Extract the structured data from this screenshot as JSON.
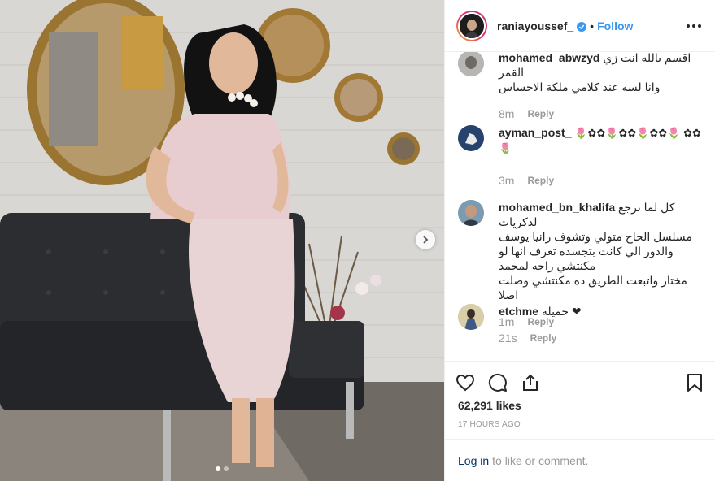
{
  "header": {
    "username": "raniayoussef_",
    "separator": "•",
    "follow_label": "Follow"
  },
  "comments": [
    {
      "username": "mohamed_abwzyd",
      "text_line1": "اقسم بالله انت زي القمر",
      "text_line2": "وانا لسه عند كلامي ملكة الاحساس",
      "time": "8m",
      "reply": "Reply"
    },
    {
      "username": "ayman_post_",
      "text": "🌷✿✿🌷✿✿🌷✿✿🌷 ✿✿🌷",
      "time": "3m",
      "reply": "Reply"
    },
    {
      "username": "mohamed_bn_khalifa",
      "text_line1": "كل لما ترجع لذكريات",
      "text_line2": "مسلسل الحاج متولي وتشوف رانيا يوسف والدور الي كانت بتجسده تعرف انها لو مكنتشي راحه لمحمد",
      "text_line3": "مختار واتبعت الطريق ده مكنتشي وصلت اصلا",
      "time": "1m",
      "reply": "Reply"
    },
    {
      "username": "etchme",
      "text": "جميلة ❤",
      "time": "21s",
      "reply": "Reply"
    }
  ],
  "likes": "62,291 likes",
  "posted_ago": "17 HOURS AGO",
  "login": {
    "link": "Log in",
    "rest": "to like or comment."
  },
  "carousel": {
    "total": 2,
    "active_index": 0
  },
  "colors": {
    "follow_blue": "#3897f0",
    "verified_blue": "#3897f0",
    "muted_gray": "#999999"
  }
}
